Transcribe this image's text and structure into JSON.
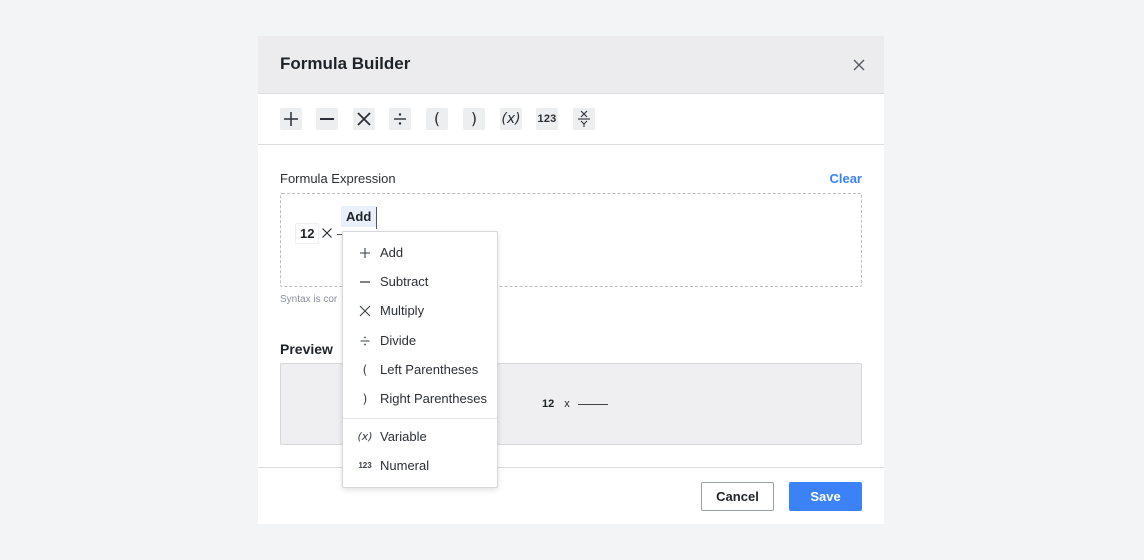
{
  "dialog": {
    "title": "Formula Builder",
    "close_icon": "close-icon"
  },
  "toolbar": {
    "buttons": [
      {
        "name": "add",
        "icon": "plus-icon"
      },
      {
        "name": "subtract",
        "icon": "minus-icon"
      },
      {
        "name": "multiply",
        "icon": "multiply-icon"
      },
      {
        "name": "divide",
        "icon": "divide-icon"
      },
      {
        "name": "left-paren",
        "label": "("
      },
      {
        "name": "right-paren",
        "label": ")"
      },
      {
        "name": "variable",
        "label": "(x)"
      },
      {
        "name": "numeral",
        "label": "123"
      },
      {
        "name": "fraction",
        "icon": "fraction-icon"
      }
    ]
  },
  "expression": {
    "label": "Formula Expression",
    "clear_label": "Clear",
    "tokens": {
      "number": "12",
      "operator_icon": "multiply-icon",
      "active": "Add"
    },
    "hint": "Syntax is cor"
  },
  "preview": {
    "label": "Preview",
    "number": "12",
    "operator": "x"
  },
  "footer": {
    "cancel_label": "Cancel",
    "save_label": "Save"
  },
  "menu": {
    "items": [
      {
        "label": "Add",
        "icon": "plus-icon"
      },
      {
        "label": "Subtract",
        "icon": "minus-icon"
      },
      {
        "label": "Multiply",
        "icon": "multiply-icon"
      },
      {
        "label": "Divide",
        "icon": "divide-icon"
      },
      {
        "label": "Left Parentheses",
        "icon_text": "("
      },
      {
        "label": "Right Parentheses",
        "icon_text": ")"
      },
      {
        "label": "Variable",
        "icon_text": "(x)"
      },
      {
        "label": "Numeral",
        "icon_text": "123"
      }
    ]
  },
  "colors": {
    "accent": "#3b82f6",
    "header_bg": "#ececee",
    "page_bg": "#f3f4f6"
  }
}
